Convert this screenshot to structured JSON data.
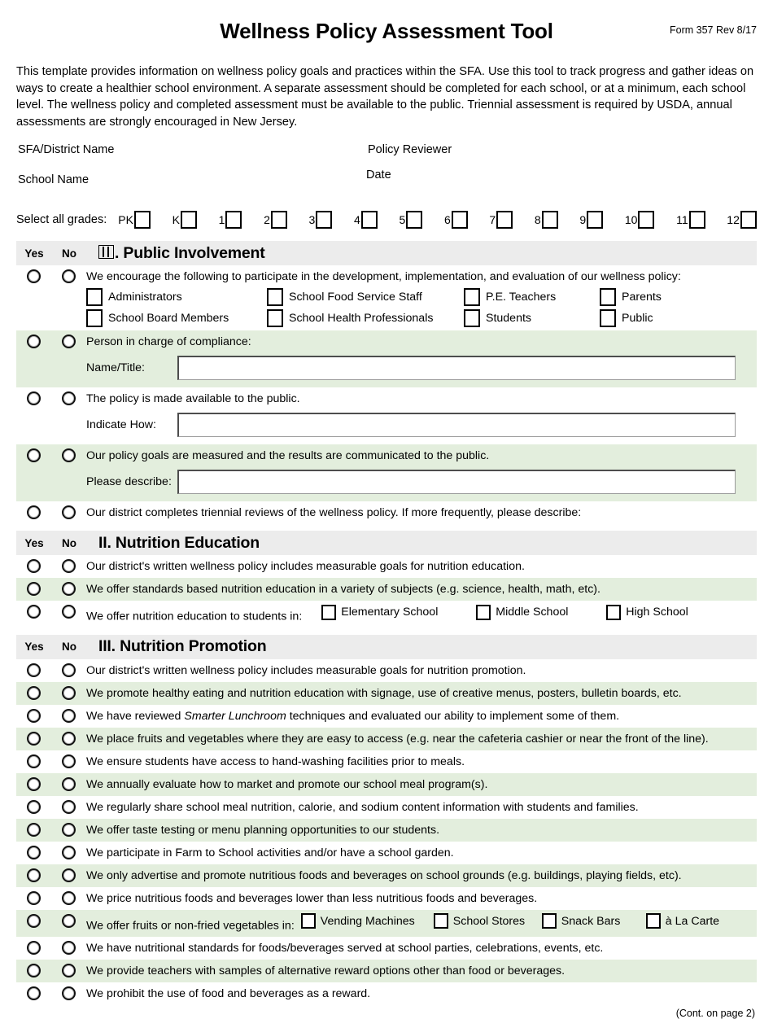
{
  "header": {
    "title": "Wellness Policy Assessment Tool",
    "form_rev": "Form 357 Rev 8/17",
    "intro": "This template provides information on wellness policy goals and practices within the SFA. Use this tool to track progress and gather ideas on ways to create a healthier school environment. A separate assessment should be completed for each school, or at a minimum, each school level. The wellness policy and completed assessment must be available to the public. Triennial assessment is required by USDA, annual assessments are strongly encouraged in New Jersey."
  },
  "identity": {
    "sfa_label": "SFA/District Name",
    "reviewer_label": "Policy Reviewer",
    "school_label": "School Name",
    "date_label": "Date"
  },
  "grades": {
    "label": "Select all grades:",
    "options": [
      "PK",
      "K",
      "1",
      "2",
      "3",
      "4",
      "5",
      "6",
      "7",
      "8",
      "9",
      "10",
      "11",
      "12"
    ]
  },
  "columns": {
    "yes": "Yes",
    "no": "No"
  },
  "sections": [
    {
      "number": "I",
      "title": ". Public Involvement",
      "rows": [
        {
          "text": "We encourage the following to participate in the development, implementation, and evaluation of our wellness policy:",
          "checkbox_rows": [
            [
              "Administrators",
              "School Food Service Staff",
              "P.E. Teachers",
              "Parents"
            ],
            [
              "School Board Members",
              "School Health Professionals",
              "Students",
              "Public"
            ]
          ]
        },
        {
          "text": "Person in charge of compliance:",
          "field_label": "Name/Title:"
        },
        {
          "text": "The policy is made available to the public.",
          "field_label": "Indicate How:"
        },
        {
          "text": "Our policy goals are measured and the results are communicated to the public.",
          "field_label": "Please describe:"
        },
        {
          "text": "Our district completes triennial reviews of the wellness policy. If more frequently, please describe:"
        }
      ]
    },
    {
      "number": "II",
      "title": ". Nutrition Education",
      "rows": [
        {
          "text": "Our district's written wellness policy includes measurable goals for nutrition education."
        },
        {
          "text": "We offer standards based nutrition education in a variety of subjects (e.g. science, health, math, etc)."
        },
        {
          "text": "We offer nutrition education to students in:",
          "inline_checkboxes": [
            "Elementary School",
            "Middle School",
            "High School"
          ]
        }
      ]
    },
    {
      "number": "III",
      "title": ". Nutrition Promotion",
      "rows": [
        {
          "text": "Our district's written wellness policy includes measurable goals for nutrition promotion."
        },
        {
          "text": "We promote healthy eating and nutrition education with signage, use of creative menus, posters, bulletin boards, etc."
        },
        {
          "text_before": "We have reviewed ",
          "italic": "Smarter Lunchroom",
          "text_after": " techniques and evaluated our ability to implement some of them."
        },
        {
          "text": "We place fruits and vegetables where they are easy to access (e.g. near the cafeteria cashier or near the front of the line)."
        },
        {
          "text": "We ensure students have access to hand-washing facilities prior to meals."
        },
        {
          "text": "We annually evaluate how to market and promote our school meal program(s)."
        },
        {
          "text": "We regularly share school meal nutrition, calorie, and sodium content information with students and families."
        },
        {
          "text": "We offer taste testing or menu planning opportunities to our students."
        },
        {
          "text": "We participate in Farm to School activities and/or have a school garden."
        },
        {
          "text": "We only advertise and promote nutritious foods and beverages on school grounds (e.g. buildings, playing fields, etc)."
        },
        {
          "text": "We price nutritious foods and beverages lower than less nutritious foods and beverages."
        },
        {
          "text": "We offer fruits or non-fried vegetables in:",
          "inline_checkboxes": [
            "Vending Machines",
            "School Stores",
            "Snack Bars",
            "à La Carte"
          ]
        },
        {
          "text": "We have nutritional standards for foods/beverages served at school parties, celebrations, events, etc."
        },
        {
          "text": "We provide teachers with samples of alternative reward options other than food or beverages."
        },
        {
          "text": "We prohibit the use of food and beverages as a reward."
        }
      ]
    }
  ],
  "footer": {
    "continuation": "(Cont. on page 2)"
  },
  "colors": {
    "alt_row": "#e3eedd",
    "section_band": "#ececec",
    "text": "#000000"
  }
}
